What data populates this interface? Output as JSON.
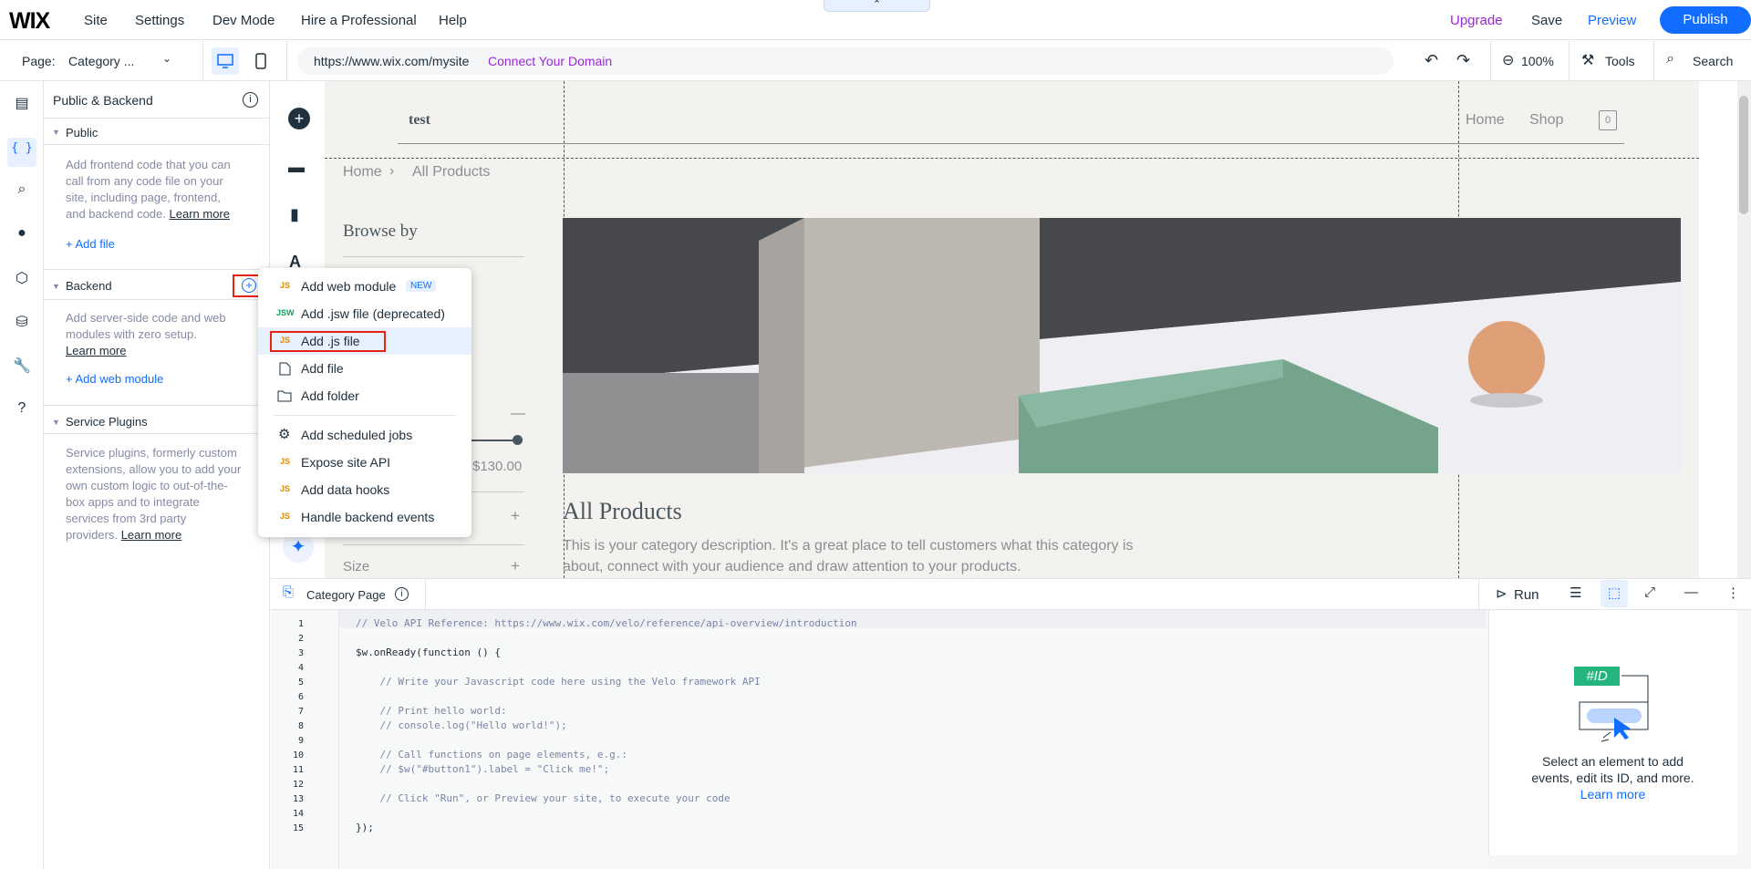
{
  "topbar": {
    "logo": "WIX",
    "nav": [
      "Site",
      "Settings",
      "Dev Mode",
      "Hire a Professional",
      "Help"
    ],
    "upgrade": "Upgrade",
    "save": "Save",
    "preview": "Preview",
    "publish": "Publish",
    "collapse": "⌃"
  },
  "secondbar": {
    "page_label": "Page:",
    "page_value": "Category ...",
    "url": "https://www.wix.com/mysite",
    "connect": "Connect Your Domain",
    "zoom": "100%",
    "tools": "Tools",
    "search": "Search"
  },
  "panel": {
    "title": "Public & Backend",
    "public": {
      "header": "Public",
      "desc": [
        "Add frontend code that you can",
        "call from any code file on your",
        "site, including page, frontend,",
        "and backend code."
      ],
      "learn": "Learn more",
      "add": "+ Add file"
    },
    "backend": {
      "header": "Backend",
      "desc": [
        "Add server-side code and web",
        "modules with zero setup."
      ],
      "learn": "Learn more",
      "add": "+ Add web module"
    },
    "plugins": {
      "header": "Service Plugins",
      "desc": [
        "Service plugins, formerly custom",
        "extensions, allow you to add your",
        "own custom logic to out-of-the-",
        "box apps and to integrate",
        "services from 3rd party",
        "providers."
      ],
      "learn": "Learn more"
    }
  },
  "menu": {
    "items": [
      {
        "icon": "JS",
        "label": "Add web module",
        "badge": "NEW"
      },
      {
        "icon": "JSW",
        "label": "Add .jsw file (deprecated)"
      },
      {
        "icon": "JS",
        "label": "Add .js file"
      },
      {
        "icon": "file-icon",
        "label": "Add file"
      },
      {
        "icon": "folder-icon",
        "label": "Add folder"
      },
      {
        "icon": "gear-icon",
        "label": "Add scheduled jobs"
      },
      {
        "icon": "JS",
        "label": "Expose site API"
      },
      {
        "icon": "JS",
        "label": "Add data hooks"
      },
      {
        "icon": "JS",
        "label": "Handle backend events"
      }
    ]
  },
  "site": {
    "name": "test",
    "nav": [
      "Home",
      "Shop"
    ],
    "cart": "0",
    "breadcrumb": [
      "Home",
      "All Products"
    ],
    "browse": "Browse by",
    "price": "$130.00",
    "size": "Size",
    "heading": "All Products",
    "desc1": "This is your category description. It's a great place to tell customers what this category is",
    "desc2": "about, connect with your audience and draw attention to your products."
  },
  "code": {
    "tab": "Category Page",
    "run": "Run",
    "lines": [
      "// Velo API Reference: https://www.wix.com/velo/reference/api-overview/introduction",
      "",
      "$w.onReady(function () {",
      "",
      "    // Write your Javascript code here using the Velo framework API",
      "",
      "    // Print hello world:",
      "    // console.log(\"Hello world!\");",
      "",
      "    // Call functions on page elements, e.g.:",
      "    // $w(\"#button1\").label = \"Click me!\";",
      "",
      "    // Click \"Run\", or Preview your site, to execute your code",
      "",
      "});"
    ]
  },
  "rightpanel": {
    "id_tag": "#ID",
    "text1": "Select an element to add",
    "text2": "events, edit its ID, and more.",
    "learn": "Learn more"
  },
  "colors": {
    "accent": "#116dff",
    "upgrade": "#9a27d5",
    "highlight": "#e7f0ff",
    "red": "#e62214"
  }
}
